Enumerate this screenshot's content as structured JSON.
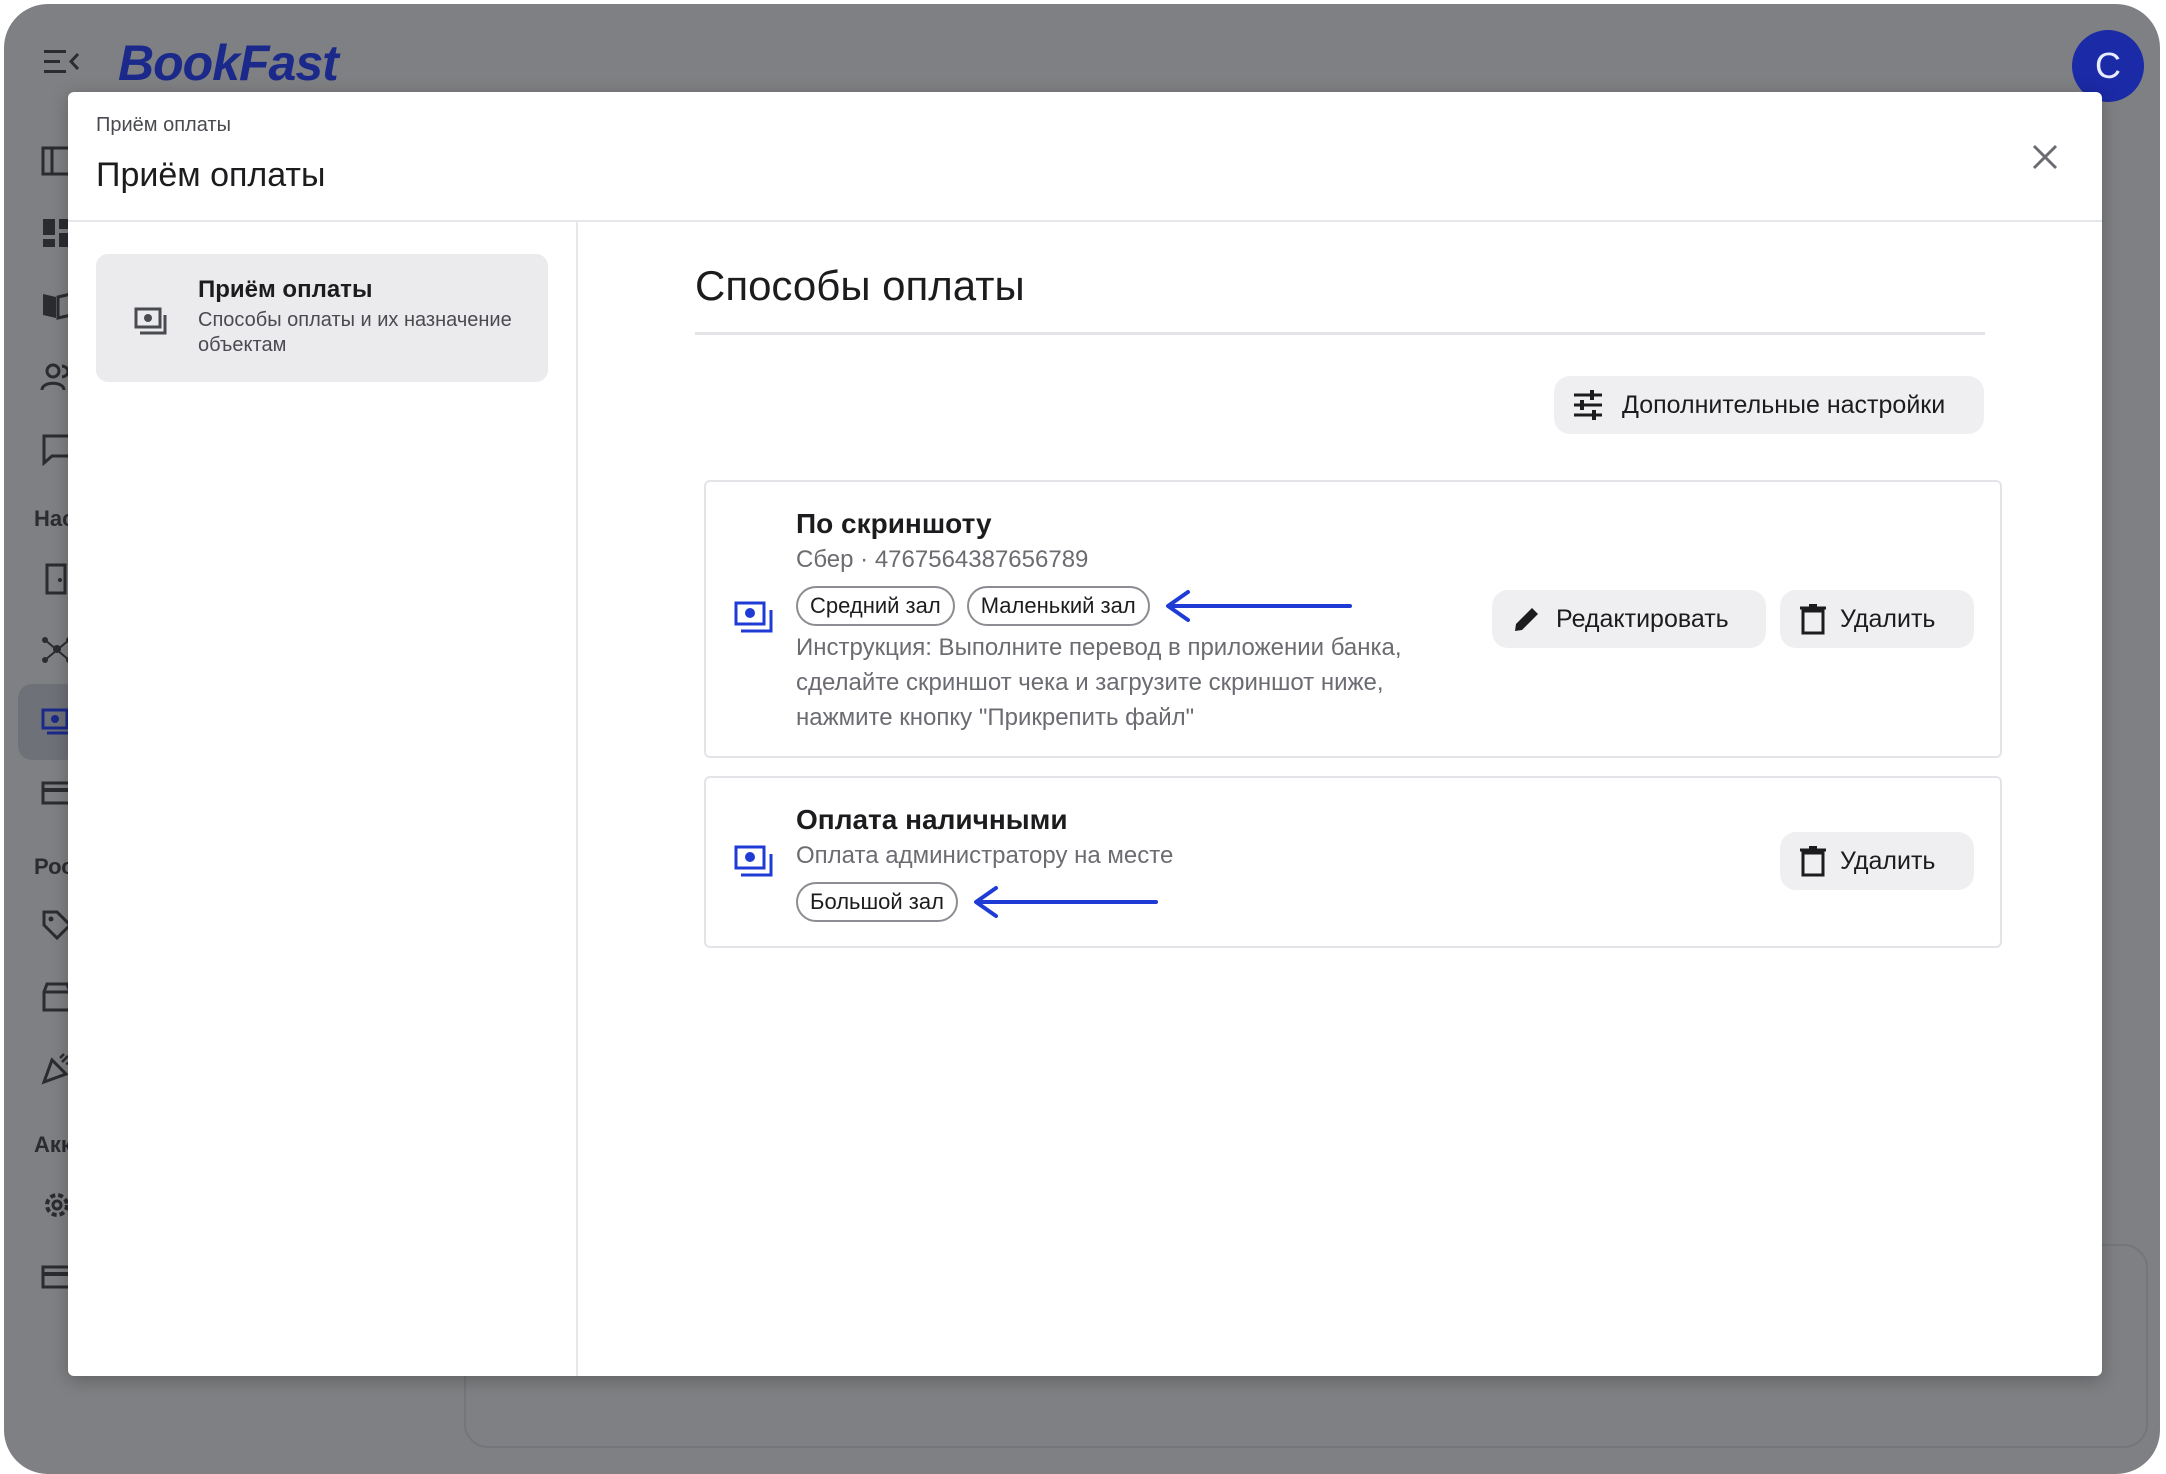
{
  "app": {
    "logo_text": "BookFast",
    "avatar_initial": "C",
    "brand_color": "#1b2a8a",
    "rail_sections": [
      "Нас",
      "Рос",
      "Акк"
    ]
  },
  "modal": {
    "breadcrumb": "Приём оплаты",
    "title": "Приём оплаты",
    "close_icon": "close-icon",
    "nav": {
      "title": "Приём оплаты",
      "subtitle": "Способы оплаты и их назначение объектам",
      "icon": "payments-icon"
    }
  },
  "content": {
    "section_title": "Способы оплаты",
    "advanced_button": "Дополнительные настройки",
    "methods": [
      {
        "name": "По скриншоту",
        "detail": "Сбер · 4767564387656789",
        "tags": [
          "Средний зал",
          "Маленький зал"
        ],
        "instruction": "Инструкция: Выполните перевод в приложении банка, сделайте скриншот чека и загрузите скриншот ниже, нажмите кнопку \"Прикрепить файл\"",
        "edit_label": "Редактировать",
        "delete_label": "Удалить"
      },
      {
        "name": "Оплата наличными",
        "detail": "Оплата администратору на месте",
        "tags": [
          "Большой зал"
        ],
        "delete_label": "Удалить"
      }
    ]
  },
  "annotation_color": "#1f3bd6"
}
